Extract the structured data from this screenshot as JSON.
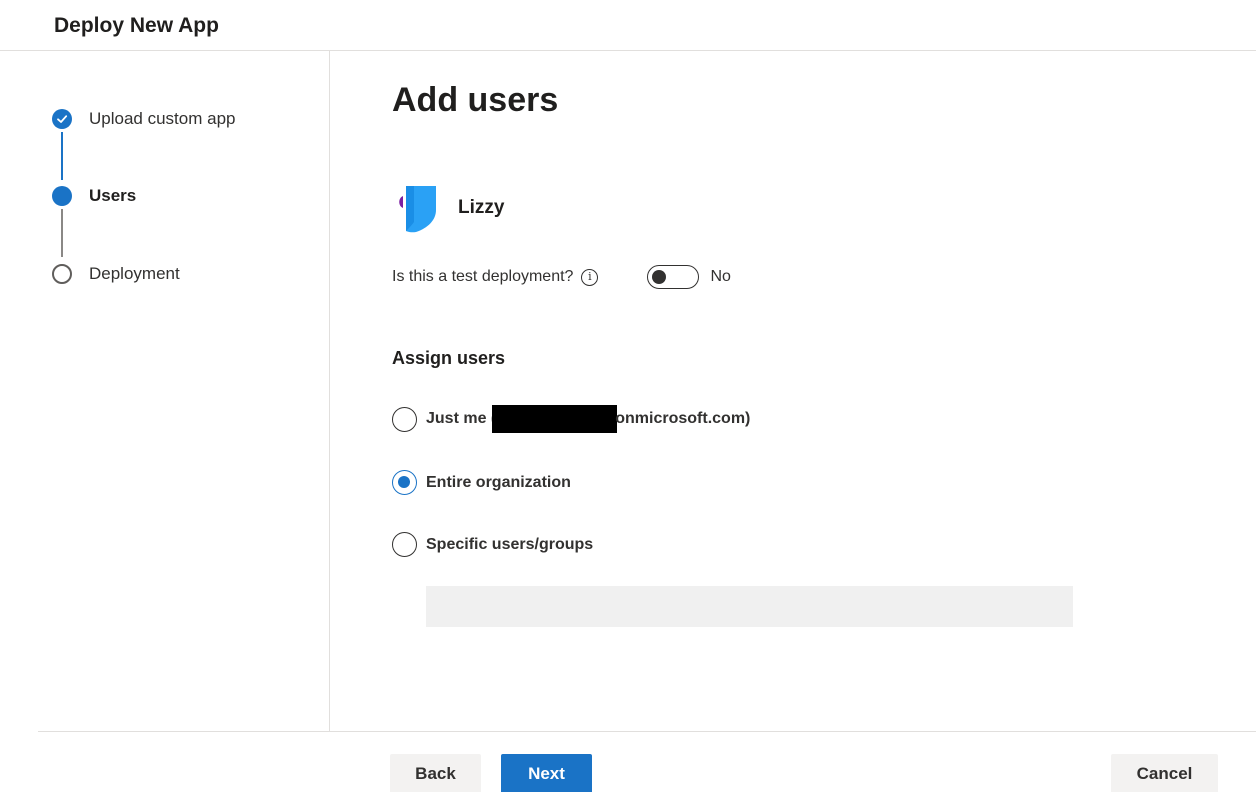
{
  "header": {
    "title": "Deploy New App"
  },
  "steps": [
    {
      "label": "Upload custom app",
      "state": "completed"
    },
    {
      "label": "Users",
      "state": "current"
    },
    {
      "label": "Deployment",
      "state": "pending"
    }
  ],
  "main": {
    "title": "Add users",
    "app": {
      "name": "Lizzy",
      "icon": "app-logo"
    },
    "test_deployment": {
      "question": "Is this a test deployment?",
      "info_icon": "info-icon",
      "toggle_label": "No",
      "toggle_on": false
    },
    "assign_users": {
      "title": "Assign users",
      "options": [
        {
          "label_prefix": "Just me (",
          "label_suffix": "onmicrosoft.com)",
          "selected": false
        },
        {
          "label": "Entire organization",
          "selected": true
        },
        {
          "label": "Specific users/groups",
          "selected": false
        }
      ],
      "picker_placeholder": ""
    }
  },
  "footer": {
    "back_label": "Back",
    "next_label": "Next",
    "cancel_label": "Cancel"
  },
  "colors": {
    "accent": "#1a73c6",
    "logo_blue": "#2aa1f5",
    "logo_purple": "#7b1fa2"
  }
}
